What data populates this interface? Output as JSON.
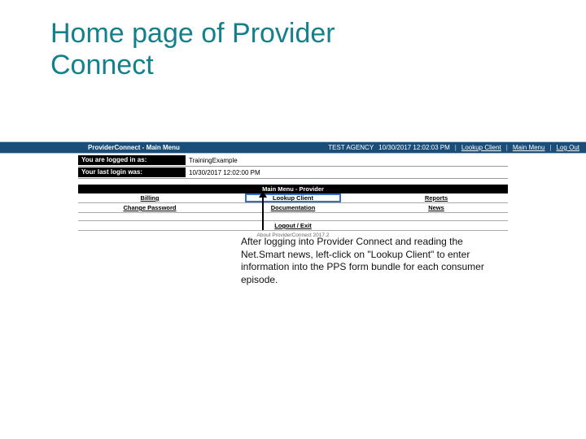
{
  "slide": {
    "title": "Home page of Provider Connect",
    "caption": "After logging into Provider Connect and reading the Net.Smart news, left-click on \"Lookup Client\" to enter information into the PPS form bundle for each consumer episode."
  },
  "topbar": {
    "title": "ProviderConnect - Main Menu",
    "agency": "TEST AGENCY",
    "timestamp": "10/30/2017 12:02:03 PM",
    "links": {
      "lookup": "Lookup Client",
      "mainmenu": "Main Menu",
      "logout": "Log Out"
    }
  },
  "info": {
    "loggedin_label": "You are logged in as:",
    "loggedin_value": "TrainingExample",
    "lastlogin_label": "Your last login was:",
    "lastlogin_value": "10/30/2017 12:02:00 PM"
  },
  "menu": {
    "header": "Main Menu - Provider",
    "row1": {
      "c1": "Billing",
      "c2": "Lookup Client",
      "c3": "Reports"
    },
    "row2": {
      "c1": "Change Password",
      "c2": "Documentation",
      "c3": "News"
    },
    "row3": {
      "c1": "Logout / Exit"
    },
    "footer": "About ProviderConnect 2017.2"
  }
}
